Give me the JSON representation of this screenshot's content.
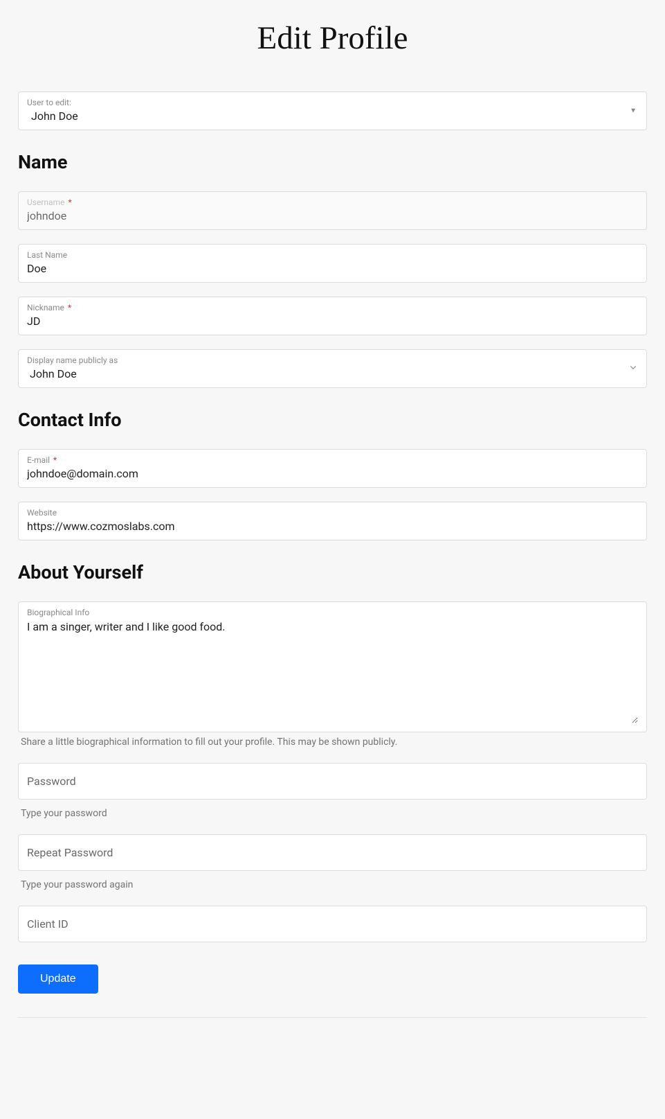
{
  "page": {
    "title": "Edit Profile"
  },
  "user_select": {
    "label": "User to edit:",
    "value": "John Doe"
  },
  "sections": {
    "name": "Name",
    "contact": "Contact Info",
    "about": "About Yourself"
  },
  "fields": {
    "username": {
      "label": "Username",
      "required": true,
      "value": "johndoe"
    },
    "last_name": {
      "label": "Last Name",
      "required": false,
      "value": "Doe"
    },
    "nickname": {
      "label": "Nickname",
      "required": true,
      "value": "JD"
    },
    "display_name": {
      "label": "Display name publicly as",
      "value": "John Doe"
    },
    "email": {
      "label": "E-mail",
      "required": true,
      "value": "johndoe@domain.com"
    },
    "website": {
      "label": "Website",
      "required": false,
      "value": "https://www.cozmoslabs.com"
    },
    "bio": {
      "label": "Biographical Info",
      "value": "I am a singer, writer and I like good food.",
      "help": "Share a little biographical information to fill out your profile. This may be shown publicly."
    },
    "password": {
      "placeholder": "Password",
      "help": "Type your password"
    },
    "repeat_password": {
      "placeholder": "Repeat Password",
      "help": "Type your password again"
    },
    "client_id": {
      "placeholder": "Client ID"
    }
  },
  "buttons": {
    "update": "Update"
  },
  "required_marker": "*"
}
